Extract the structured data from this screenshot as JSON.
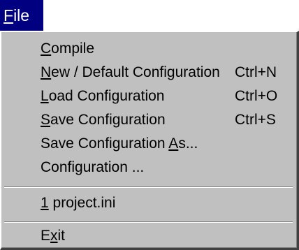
{
  "menubar": {
    "file_label": "File",
    "file_mnemonic": "F"
  },
  "menu": {
    "items": [
      {
        "pre": "",
        "key": "C",
        "post": "ompile",
        "shortcut": ""
      },
      {
        "pre": "",
        "key": "N",
        "post": "ew / Default Configuration",
        "shortcut": "Ctrl+N"
      },
      {
        "pre": "",
        "key": "L",
        "post": "oad Configuration",
        "shortcut": "Ctrl+O"
      },
      {
        "pre": "",
        "key": "S",
        "post": "ave Configuration",
        "shortcut": "Ctrl+S"
      },
      {
        "pre": "Save Configuration ",
        "key": "A",
        "post": "s...",
        "shortcut": ""
      },
      {
        "pre": "Configuration ...",
        "key": "",
        "post": "",
        "shortcut": ""
      },
      {
        "pre": "",
        "key": "1",
        "post": " project.ini",
        "shortcut": ""
      },
      {
        "pre": "E",
        "key": "x",
        "post": "it",
        "shortcut": ""
      }
    ]
  }
}
